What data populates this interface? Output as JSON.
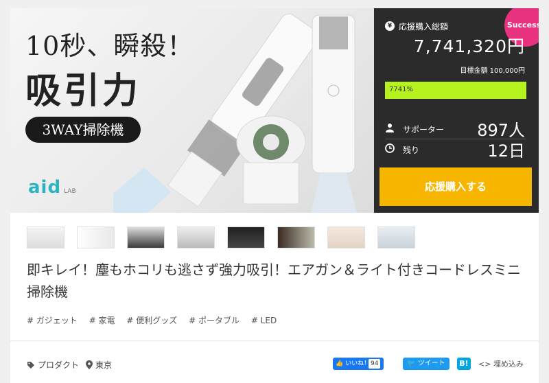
{
  "hero": {
    "headline_1": "10秒、瞬殺！",
    "headline_2": "吸引力",
    "pill": "3WAY掃除機",
    "logo": "aid",
    "logo_sub": "LAB"
  },
  "panel": {
    "badge": "Success!",
    "yen_icon": "¥",
    "total_label": "応援購入総額",
    "total_amount": "7,741,320円",
    "goal": "目標金額 100,000円",
    "progress_text": "7741%",
    "progress_fraction": 1.0,
    "supporters_label": "サポーター",
    "supporters_value": "897人",
    "remaining_label": "残り",
    "remaining_value": "12日",
    "buy_button": "応援購入する",
    "accent_color": "#f7b500",
    "bar_color": "#b6f21e",
    "badge_color": "#e8327f"
  },
  "thumbnails": [
    {
      "name": "thumb-1"
    },
    {
      "name": "thumb-2"
    },
    {
      "name": "thumb-3"
    },
    {
      "name": "thumb-4"
    },
    {
      "name": "thumb-5"
    },
    {
      "name": "thumb-6"
    },
    {
      "name": "thumb-7"
    },
    {
      "name": "thumb-8"
    }
  ],
  "title": "即キレイ！塵もホコリも逃さず強力吸引！エアガン＆ライト付きコードレスミニ掃除機",
  "tags": [
    "# ガジェット",
    "# 家電",
    "# 便利グッズ",
    "# ポータブル",
    "# LED"
  ],
  "footer": {
    "category": "プロダクト",
    "location": "東京",
    "fb_label": "いいね！",
    "fb_count": "94",
    "tweet_label": "ツイート",
    "hatena_label": "B!",
    "embed_label": "埋め込み"
  }
}
